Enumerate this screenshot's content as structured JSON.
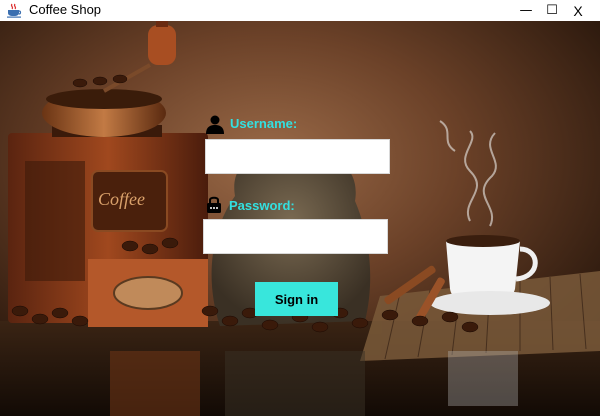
{
  "window": {
    "title": "Coffee Shop",
    "minimize_glyph": "—",
    "maximize_glyph": "☐",
    "close_glyph": "X"
  },
  "background": {
    "grinder_label": "Coffee",
    "colors": {
      "wall_light": "#8a5c3c",
      "wall_dark": "#2e1a0e",
      "bean": "#3a1e0e",
      "copper": "#b06a3a"
    }
  },
  "login": {
    "username_label": "Username:",
    "username_value": "",
    "password_label": "Password:",
    "password_value": "",
    "signin_label": "Sign in",
    "accent_color": "#33e0e0",
    "button_color": "#38e6dc"
  },
  "icons": {
    "app": "coffee-cup-icon",
    "user": "user-icon",
    "password": "lock-icon"
  }
}
